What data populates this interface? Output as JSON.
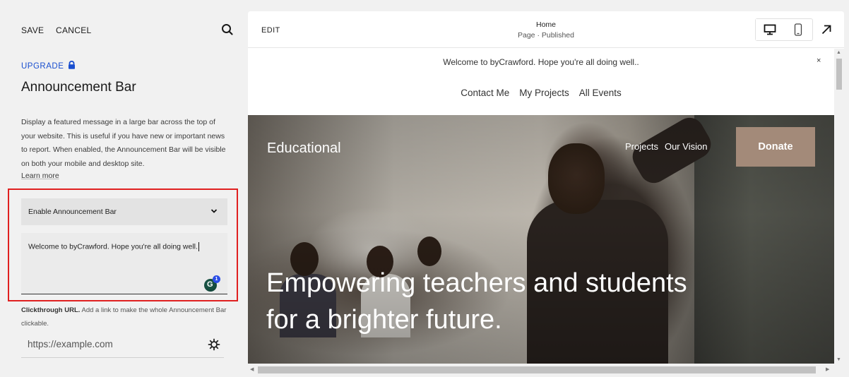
{
  "sidebar": {
    "save_label": "SAVE",
    "cancel_label": "CANCEL",
    "search_icon": "search-icon",
    "upgrade_label": "UPGRADE",
    "title": "Announcement Bar",
    "description": "Display a featured message in a large bar across the top of your website. This is useful if you have new or important news to report. When enabled, the Announcement Bar will be visible on both your mobile and desktop site.",
    "learn_more": "Learn more",
    "enable_select": "Enable Announcement Bar",
    "message_value": "Welcome to byCrawford. Hope you're all doing well.",
    "grammarly_count": "1",
    "clickthrough_title": "Clickthrough URL.",
    "clickthrough_desc": " Add a link to make the whole Announcement Bar clickable.",
    "url_placeholder": "https://example.com",
    "colors": {
      "accent": "#1a4fcf",
      "highlight": "#e02020"
    }
  },
  "preview": {
    "edit_label": "EDIT",
    "page_title": "Home",
    "page_status": "Page · Published",
    "announcement_text": "Welcome to byCrawford. Hope you're all doing well..",
    "announcement_close": "×",
    "nav_links": [
      "Contact Me",
      "My Projects",
      "All Events"
    ],
    "hero": {
      "brand": "Educational",
      "links": [
        "Projects",
        "Our Vision"
      ],
      "donate_label": "Donate",
      "headline": "Empowering teachers and students for a brighter future."
    },
    "colors": {
      "donate": "#a38a79"
    }
  }
}
